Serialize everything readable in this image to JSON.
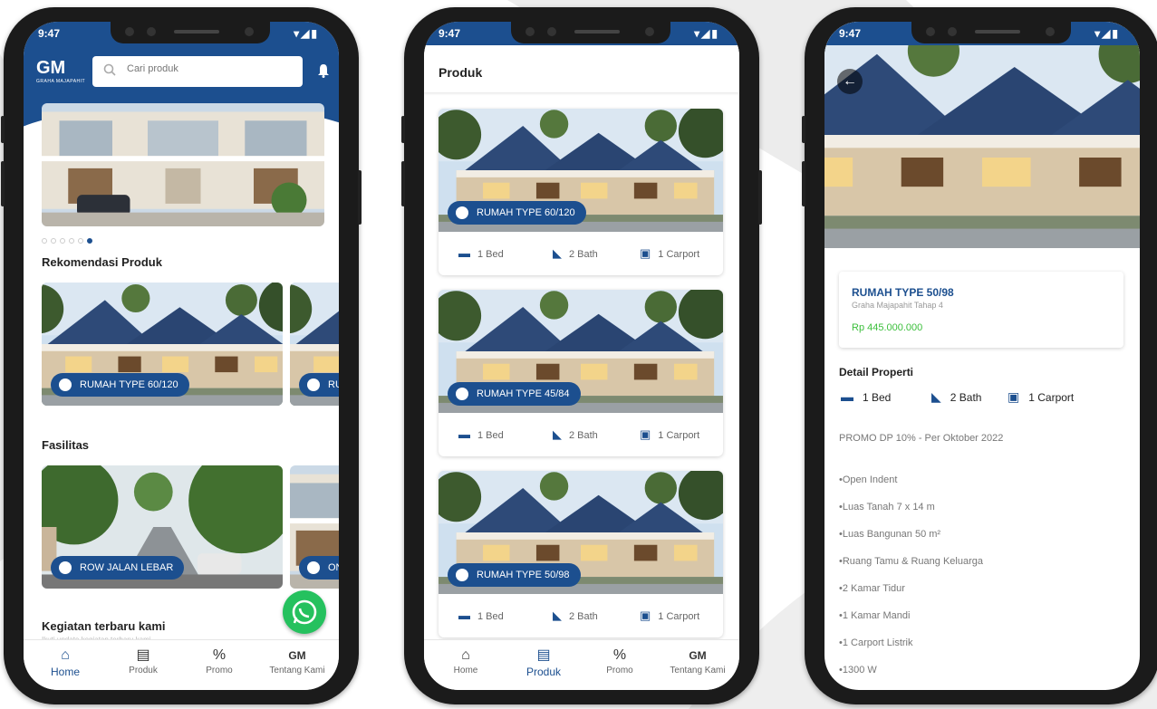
{
  "status": {
    "time": "9:47",
    "icons": "▾◢▮"
  },
  "home": {
    "search_placeholder": "Cari produk",
    "logo_text": "GM",
    "logo_sub": "GRAHA MAJAPAHIT",
    "section_recommend": "Rekomendasi Produk",
    "section_facilities": "Fasilitas",
    "section_activity": "Kegiatan terbaru kami",
    "activity_sub": "Ikuti update kegiatan terbaru kami",
    "recommend_cards": [
      {
        "label": "RUMAH TYPE 60/120"
      },
      {
        "label": "RU"
      }
    ],
    "facility_cards": [
      {
        "label": "ROW JALAN LEBAR"
      },
      {
        "label": "ON"
      }
    ]
  },
  "nav": {
    "home": "Home",
    "produk": "Produk",
    "promo": "Promo",
    "about": "Tentang Kami"
  },
  "produk": {
    "title": "Produk",
    "cards": [
      {
        "label": "RUMAH TYPE 60/120",
        "bed": "1 Bed",
        "bath": "2 Bath",
        "carport": "1 Carport"
      },
      {
        "label": "RUMAH TYPE 45/84",
        "bed": "1 Bed",
        "bath": "2 Bath",
        "carport": "1 Carport"
      },
      {
        "label": "RUMAH TYPE 50/98",
        "bed": "1 Bed",
        "bath": "2 Bath",
        "carport": "1 Carport"
      }
    ]
  },
  "detail": {
    "title": "RUMAH TYPE 50/98",
    "subtitle": "Graha Majapahit Tahap 4",
    "price": "Rp 445.000.000",
    "section": "Detail Properti",
    "bed": "1 Bed",
    "bath": "2 Bath",
    "carport": "1 Carport",
    "promo": "PROMO DP 10% - Per Oktober 2022",
    "lines": [
      "•Open Indent",
      "•Luas Tanah 7 x 14 m",
      "•Luas Bangunan 50 m²",
      "•Ruang Tamu & Ruang Keluarga",
      "•2 Kamar Tidur",
      "•1 Kamar Mandi",
      "•1 Carport Listrik",
      "•1300 W"
    ]
  },
  "colors": {
    "primary": "#1c4f8f",
    "accent_green": "#25c15e",
    "price": "#3bbf3b"
  }
}
